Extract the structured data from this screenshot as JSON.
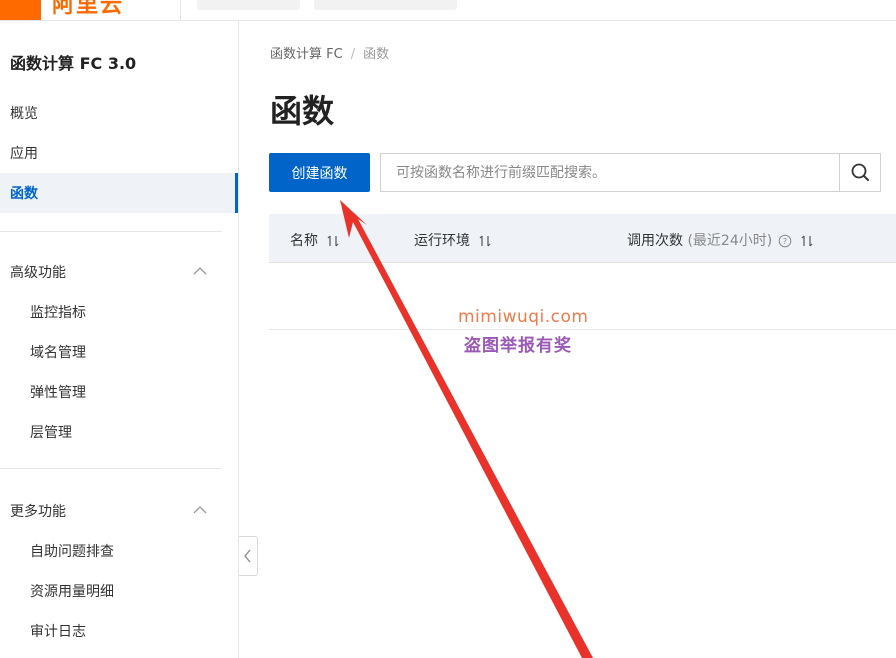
{
  "topbar": {
    "logo_icon": "aliyun-logo-icon",
    "logo_text": "阿里云",
    "brand_color": "#ff6a00"
  },
  "sidebar": {
    "title": "函数计算 FC 3.0",
    "items": [
      {
        "label": "概览",
        "active": false
      },
      {
        "label": "应用",
        "active": false
      },
      {
        "label": "函数",
        "active": true
      }
    ],
    "groups": [
      {
        "label": "高级功能",
        "expanded": true,
        "icon": "chevron-up-icon",
        "items": [
          {
            "label": "监控指标"
          },
          {
            "label": "域名管理"
          },
          {
            "label": "弹性管理"
          },
          {
            "label": "层管理"
          }
        ]
      },
      {
        "label": "更多功能",
        "expanded": true,
        "icon": "chevron-up-icon",
        "items": [
          {
            "label": "自助问题排查"
          },
          {
            "label": "资源用量明细"
          },
          {
            "label": "审计日志"
          }
        ]
      }
    ],
    "collapse_icon": "chevron-left-icon"
  },
  "breadcrumb": {
    "items": [
      "函数计算 FC",
      "函数"
    ],
    "separator": "/"
  },
  "page": {
    "title": "函数"
  },
  "toolbar": {
    "create_label": "创建函数",
    "search_placeholder": "可按函数名称进行前缀匹配搜索。",
    "search_value": "",
    "search_icon": "search-icon"
  },
  "table": {
    "columns": [
      {
        "label": "名称",
        "sortable": true
      },
      {
        "label": "运行环境",
        "sortable": true
      },
      {
        "label": "调用次数",
        "suffix": "(最近24小时)",
        "help": true,
        "sortable": true
      }
    ],
    "rows": []
  },
  "watermark": {
    "line1": "mimiwuqi.com",
    "line2": "盗图举报有奖"
  },
  "annotation": {
    "arrow_color": "#e8322a"
  },
  "colors": {
    "accent": "#0064c8",
    "active_bg": "#eff3f8",
    "table_header_bg": "#eff3f8"
  }
}
